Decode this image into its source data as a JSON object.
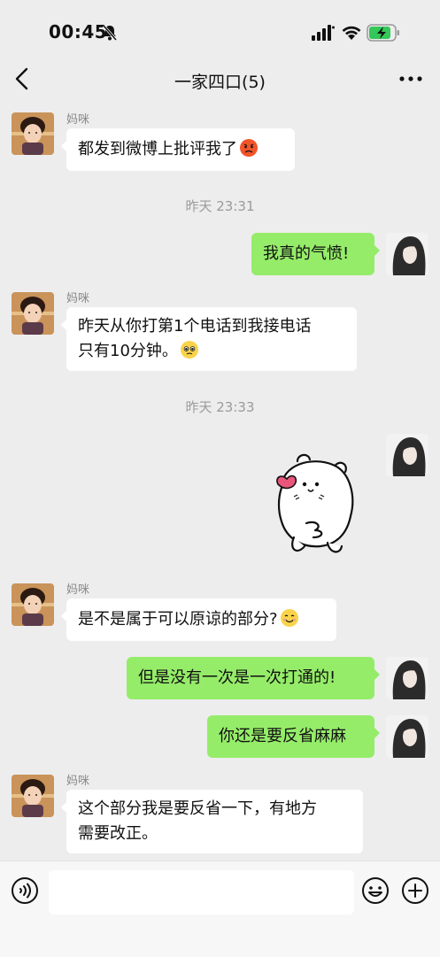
{
  "status_bar": {
    "time": "00:45"
  },
  "header": {
    "title": "一家四口(5)"
  },
  "messages": {
    "m1": {
      "sender": "妈咪",
      "text": "都发到微博上批评我了"
    },
    "t1": "昨天 23:31",
    "m2": {
      "text": "我真的气愤!"
    },
    "m3": {
      "sender": "妈咪",
      "line1": "昨天从你打第1个电话到我接电话",
      "line2": "只有10分钟。"
    },
    "t2": "昨天 23:33",
    "m4": {
      "sticker": "bear-sticker"
    },
    "m5": {
      "sender": "妈咪",
      "text": "是不是属于可以原谅的部分?"
    },
    "m6": {
      "text": "但是没有一次是一次打通的!"
    },
    "m7": {
      "text": "你还是要反省麻麻"
    },
    "m8": {
      "sender": "妈咪",
      "line1": "这个部分我是要反省一下，有地方",
      "line2": "需要改正。"
    }
  },
  "input_bar": {
    "placeholder": ""
  },
  "colors": {
    "background": "#ededed",
    "outgoing_bubble": "#95ec69",
    "incoming_bubble": "#ffffff"
  },
  "icons": [
    "bell-off-icon",
    "signal-icon",
    "wifi-icon",
    "battery-charging-icon",
    "back-icon",
    "more-icon",
    "voice-icon",
    "emoji-icon",
    "plus-icon"
  ]
}
